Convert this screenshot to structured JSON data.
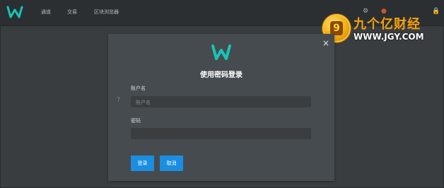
{
  "topbar": {
    "nav": [
      "通道",
      "交易",
      "区块浏览器"
    ]
  },
  "watermark": {
    "coin_text": "9",
    "brand_cn": "九个亿财经",
    "brand_en": "WWW.JGY.COM"
  },
  "modal": {
    "title": "使用密码登录",
    "close_symbol": "×",
    "username_label": "账户名",
    "username_placeholder": "账户名",
    "password_label": "密码",
    "password_value": "",
    "login_button": "登录",
    "cancel_button": "取消"
  },
  "colors": {
    "accent": "#1a8ee0",
    "logo_teal": "#17c5b7",
    "watermark_orange": "#f5a10b"
  },
  "icons": {
    "settings": "gear-icon",
    "alert": "alert-icon",
    "lock": "lock-icon",
    "help": "question-icon",
    "close": "close-icon"
  }
}
